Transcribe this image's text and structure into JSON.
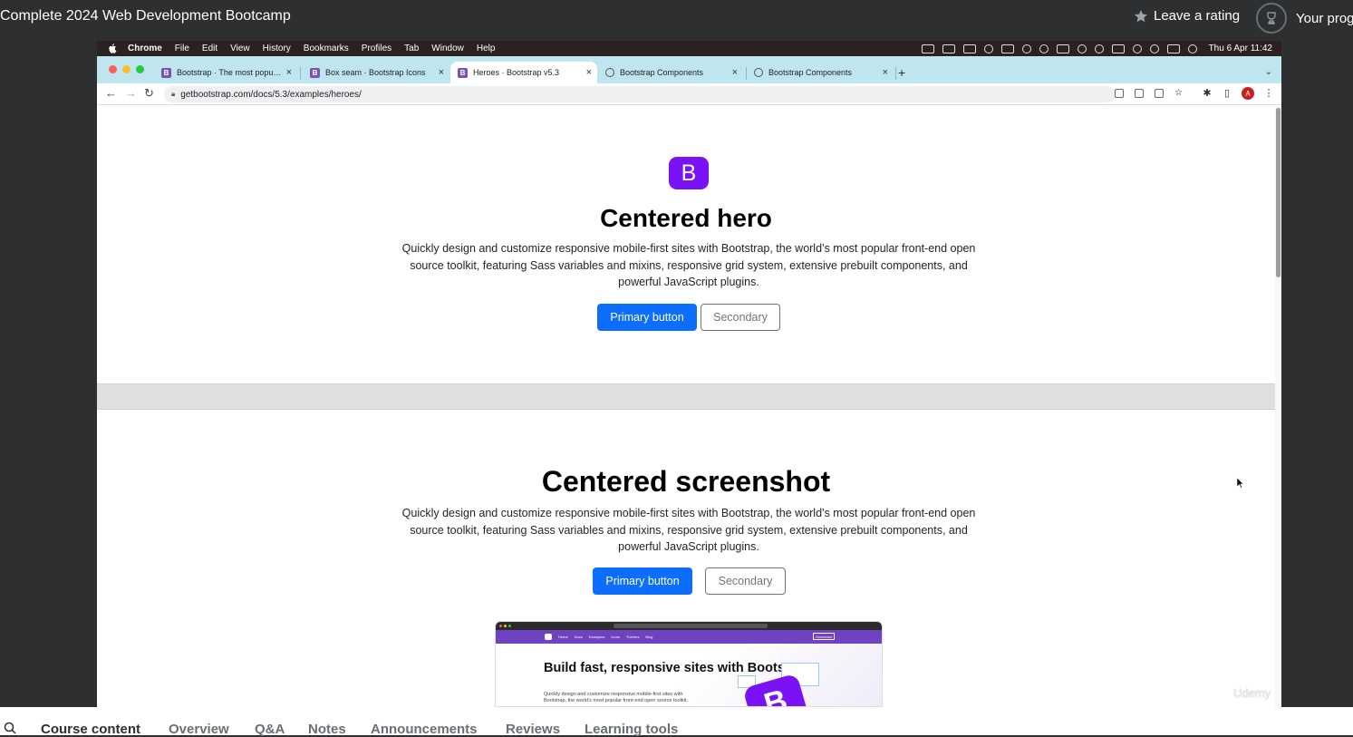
{
  "udemy": {
    "course_title": "Complete 2024 Web Development Bootcamp",
    "leave_rating": "Leave a rating",
    "your_progress": "Your progr",
    "bottom_tabs": [
      "Course content",
      "Overview",
      "Q&A",
      "Notes",
      "Announcements",
      "Reviews",
      "Learning tools"
    ],
    "watermark": "Udemy"
  },
  "mac": {
    "app_name": "Chrome",
    "menu": [
      "File",
      "Edit",
      "View",
      "History",
      "Bookmarks",
      "Profiles",
      "Tab",
      "Window",
      "Help"
    ],
    "clock": "Thu 6 Apr  11:42"
  },
  "browser": {
    "tabs": [
      {
        "label": "Bootstrap · The most popular H",
        "icon": "bootstrap-icon"
      },
      {
        "label": "Box seam · Bootstrap Icons",
        "icon": "bootstrap-icon"
      },
      {
        "label": "Heroes · Bootstrap v5.3",
        "icon": "bootstrap-icon",
        "active": true
      },
      {
        "label": "Bootstrap Components",
        "icon": "globe-icon"
      },
      {
        "label": "Bootstrap Components",
        "icon": "globe-icon"
      }
    ],
    "url": "getbootstrap.com/docs/5.3/examples/heroes/",
    "profile_initial": "A"
  },
  "hero1": {
    "logo_letter": "B",
    "title": "Centered hero",
    "text": "Quickly design and customize responsive mobile-first sites with Bootstrap, the world’s most popular front-end open source toolkit, featuring Sass variables and mixins, responsive grid system, extensive prebuilt components, and powerful JavaScript plugins.",
    "primary": "Primary button",
    "secondary": "Secondary"
  },
  "hero2": {
    "title": "Centered screenshot",
    "text": "Quickly design and customize responsive mobile-first sites with Bootstrap, the world’s most popular front-end open source toolkit, featuring Sass variables and mixins, responsive grid system, extensive prebuilt components, and powerful JavaScript plugins.",
    "primary": "Primary button",
    "secondary": "Secondary"
  },
  "preview": {
    "nav": [
      "Home",
      "Docs",
      "Examples",
      "Icons",
      "Themes",
      "Blog"
    ],
    "download": "Download",
    "heading": "Build fast, responsive sites with Bootstrap",
    "sub": "Quickly design and customize responsive mobile-first sites with Bootstrap, the world’s most popular front-end open source toolkit,",
    "logo_letter": "B"
  },
  "colors": {
    "bootstrap_purple": "#7a12f5",
    "primary_blue": "#0d6efd",
    "udemy_dark": "#2d2f31",
    "tab_strip": "#bfe5ee"
  }
}
